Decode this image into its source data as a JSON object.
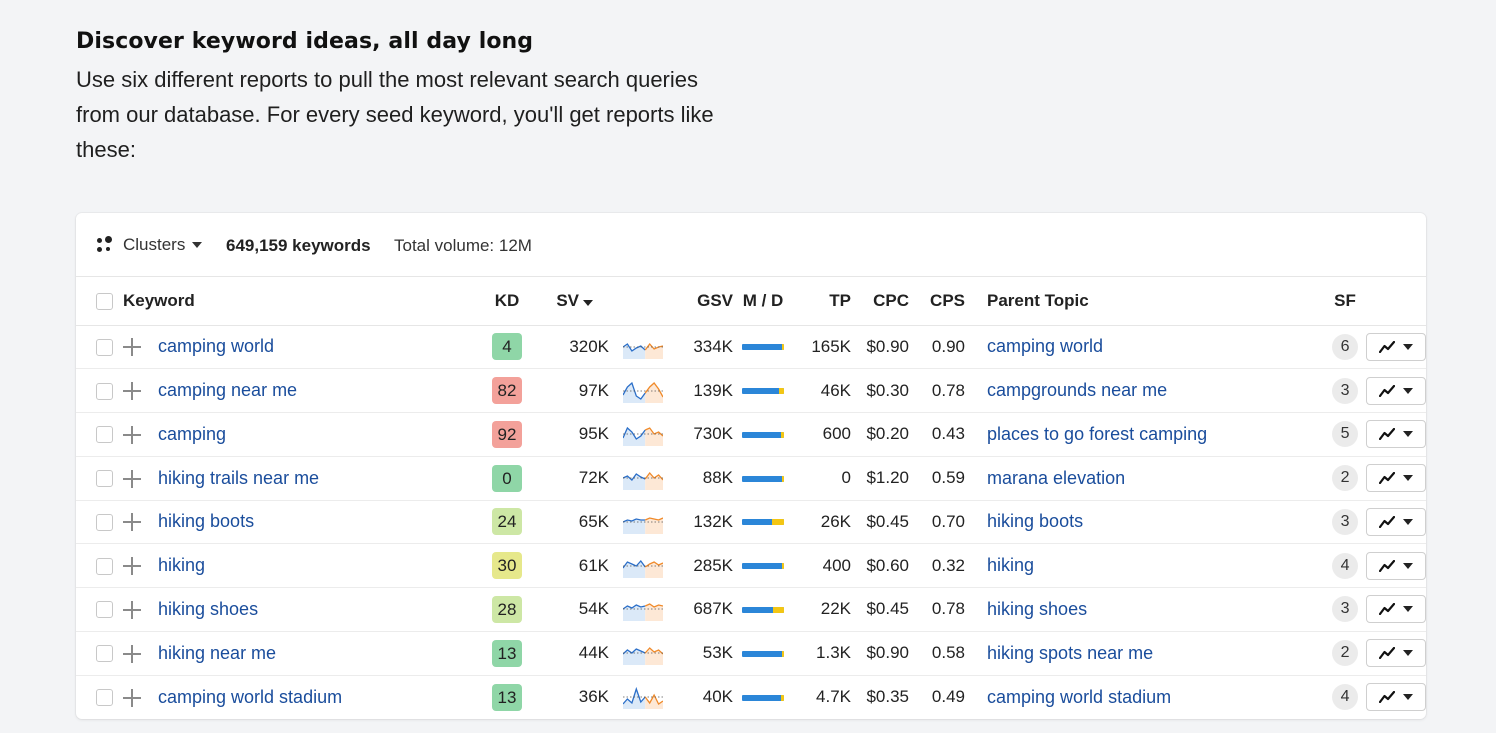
{
  "intro": {
    "heading": "Discover keyword ideas, all day long",
    "body": "Use six different reports to pull the most relevant search queries from our database. For every seed keyword, you'll get reports like these:"
  },
  "toolbar": {
    "clusters_label": "Clusters",
    "keyword_count": "649,159 keywords",
    "total_volume": "Total volume: 12M"
  },
  "columns": {
    "keyword": "Keyword",
    "kd": "KD",
    "sv": "SV",
    "gsv": "GSV",
    "md": "M / D",
    "tp": "TP",
    "cpc": "CPC",
    "cps": "CPS",
    "parent_topic": "Parent Topic",
    "sf": "SF"
  },
  "colors": {
    "kd_green": "#8fd6a7",
    "kd_red": "#f3a19a",
    "kd_lightgreen": "#cde7a5",
    "kd_yellow": "#e6e88b",
    "link": "#1a4d9c",
    "bar_blue": "#2b86d8",
    "bar_yellow": "#f3c614"
  },
  "rows": [
    {
      "keyword": "camping world",
      "kd": "4",
      "kd_color": "#8fd6a7",
      "sv": "320K",
      "gsv": "334K",
      "md_yellow_fraction": 0.04,
      "tp": "165K",
      "cpc": "$0.90",
      "cps": "0.90",
      "parent": "camping world",
      "sf": "6",
      "trend": [
        10,
        13,
        6,
        9,
        11,
        7,
        13,
        8,
        10,
        11
      ],
      "trend_style": "hump"
    },
    {
      "keyword": "camping near me",
      "kd": "82",
      "kd_color": "#f3a19a",
      "sv": "97K",
      "gsv": "139K",
      "md_yellow_fraction": 0.12,
      "tp": "46K",
      "cpc": "$0.30",
      "cps": "0.78",
      "parent": "campgrounds near me",
      "sf": "3",
      "trend": [
        6,
        14,
        18,
        5,
        2,
        8,
        14,
        18,
        12,
        4
      ],
      "trend_style": "wave"
    },
    {
      "keyword": "camping",
      "kd": "92",
      "kd_color": "#f3a19a",
      "sv": "95K",
      "gsv": "730K",
      "md_yellow_fraction": 0.08,
      "tp": "600",
      "cpc": "$0.20",
      "cps": "0.43",
      "parent": "places to go forest camping",
      "sf": "5",
      "trend": [
        6,
        16,
        12,
        5,
        8,
        14,
        16,
        10,
        12,
        8
      ],
      "trend_style": "wave"
    },
    {
      "keyword": "hiking trails near me",
      "kd": "0",
      "kd_color": "#8fd6a7",
      "sv": "72K",
      "gsv": "88K",
      "md_yellow_fraction": 0.04,
      "tp": "0",
      "cpc": "$1.20",
      "cps": "0.59",
      "parent": "marana elevation",
      "sf": "2",
      "trend": [
        10,
        12,
        8,
        14,
        11,
        9,
        15,
        10,
        13,
        8
      ],
      "trend_style": "flat"
    },
    {
      "keyword": "hiking boots",
      "kd": "24",
      "kd_color": "#cde7a5",
      "sv": "65K",
      "gsv": "132K",
      "md_yellow_fraction": 0.28,
      "tp": "26K",
      "cpc": "$0.45",
      "cps": "0.70",
      "parent": "hiking boots",
      "sf": "3",
      "trend": [
        10,
        12,
        11,
        13,
        12,
        12,
        14,
        13,
        12,
        14
      ],
      "trend_style": "flat"
    },
    {
      "keyword": "hiking",
      "kd": "30",
      "kd_color": "#e6e88b",
      "sv": "61K",
      "gsv": "285K",
      "md_yellow_fraction": 0.06,
      "tp": "400",
      "cpc": "$0.60",
      "cps": "0.32",
      "parent": "hiking",
      "sf": "4",
      "trend": [
        8,
        14,
        12,
        10,
        15,
        9,
        12,
        14,
        11,
        13
      ],
      "trend_style": "hump"
    },
    {
      "keyword": "hiking shoes",
      "kd": "28",
      "kd_color": "#cde7a5",
      "sv": "54K",
      "gsv": "687K",
      "md_yellow_fraction": 0.26,
      "tp": "22K",
      "cpc": "$0.45",
      "cps": "0.78",
      "parent": "hiking shoes",
      "sf": "3",
      "trend": [
        10,
        13,
        11,
        14,
        12,
        13,
        15,
        12,
        14,
        13
      ],
      "trend_style": "flat"
    },
    {
      "keyword": "hiking near me",
      "kd": "13",
      "kd_color": "#8fd6a7",
      "sv": "44K",
      "gsv": "53K",
      "md_yellow_fraction": 0.05,
      "tp": "1.3K",
      "cpc": "$0.90",
      "cps": "0.58",
      "parent": "hiking spots near me",
      "sf": "2",
      "trend": [
        9,
        13,
        10,
        14,
        12,
        10,
        15,
        11,
        13,
        9
      ],
      "trend_style": "flat"
    },
    {
      "keyword": "camping world stadium",
      "kd": "13",
      "kd_color": "#8fd6a7",
      "sv": "36K",
      "gsv": "40K",
      "md_yellow_fraction": 0.07,
      "tp": "4.7K",
      "cpc": "$0.35",
      "cps": "0.49",
      "parent": "camping world stadium",
      "sf": "4",
      "trend": [
        3,
        8,
        4,
        18,
        5,
        10,
        4,
        12,
        3,
        6
      ],
      "trend_style": "spiky"
    }
  ]
}
